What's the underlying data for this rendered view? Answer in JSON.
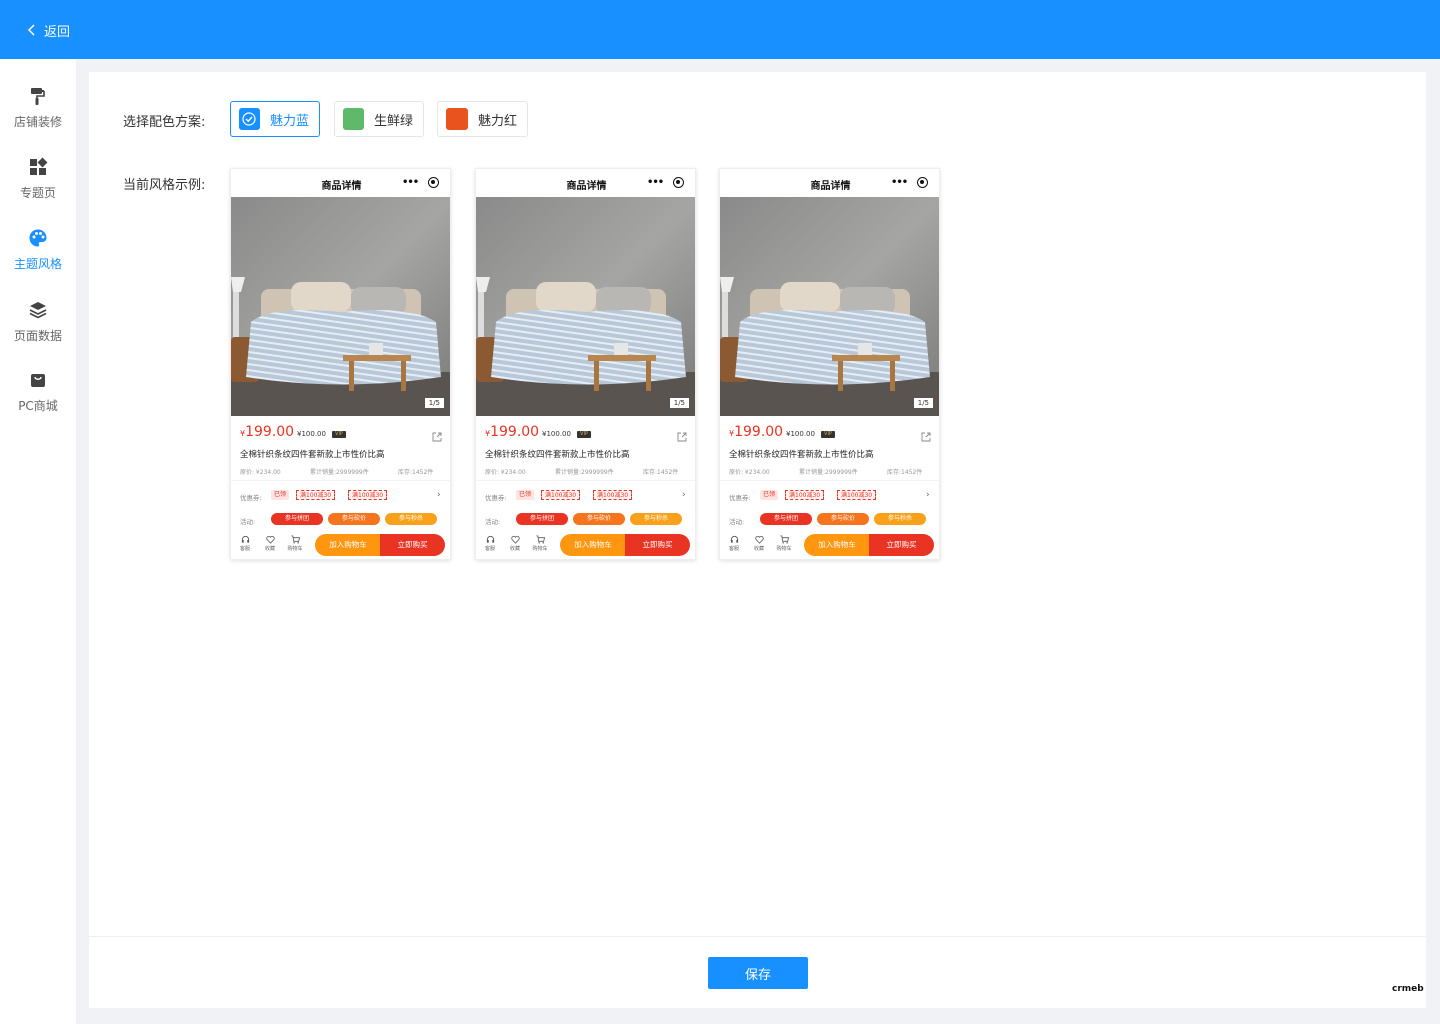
{
  "header": {
    "back_label": "返回",
    "bar_color": "#1890ff"
  },
  "sidebar": {
    "items": [
      {
        "label": "店铺装修",
        "icon": "paint-roller-icon",
        "active": false
      },
      {
        "label": "专题页",
        "icon": "grid-icon",
        "active": false
      },
      {
        "label": "主题风格",
        "icon": "palette-icon",
        "active": true
      },
      {
        "label": "页面数据",
        "icon": "layers-icon",
        "active": false
      },
      {
        "label": "PC商城",
        "icon": "shop-bag-icon",
        "active": false
      }
    ]
  },
  "scheme": {
    "label": "选择配色方案:",
    "options": [
      {
        "name": "魅力蓝",
        "color": "#1890ff",
        "selected": true
      },
      {
        "name": "生鲜绿",
        "color": "#5eb96b",
        "selected": false
      },
      {
        "name": "魅力红",
        "color": "#e9541c",
        "selected": false
      }
    ]
  },
  "preview": {
    "label": "当前风格示例:",
    "phone": {
      "title": "商品详情",
      "pager": "1/5",
      "price_symbol": "¥",
      "price": "199.00",
      "vip_price": "¥100.00",
      "vip_badge": "VIP",
      "product_name": "全棉针织条纹四件套新款上市性价比高",
      "original_price": "原价: ¥234.00",
      "sales": "累计销量:2999999件",
      "stock": "库存:1452件",
      "coupon_label": "优惠券:",
      "coupon_got": "已领",
      "coupons": [
        "满100减30",
        "满100减30"
      ],
      "activity_label": "活动:",
      "activities": [
        "参与拼团",
        "参与砍价",
        "参与秒杀"
      ],
      "bottom_icons": [
        {
          "label": "客服",
          "icon": "headset-icon"
        },
        {
          "label": "收藏",
          "icon": "heart-icon"
        },
        {
          "label": "购物车",
          "icon": "cart-icon"
        }
      ],
      "add_cart": "加入购物车",
      "buy_now": "立即购买"
    }
  },
  "footer": {
    "save_label": "保存",
    "logo_text": "crmeb"
  }
}
